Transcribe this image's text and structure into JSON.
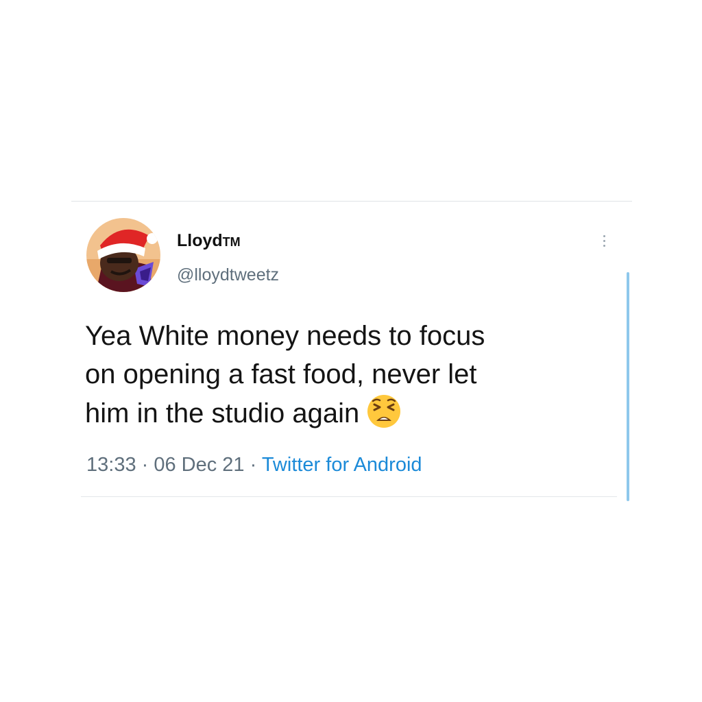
{
  "tweet": {
    "display_name": "Lloyd",
    "name_suffix": "TM",
    "handle": "@lloydtweetz",
    "text_lines": [
      "Yea White money needs to focus",
      "on opening a fast food, never let",
      "him in the studio again"
    ],
    "emoji": "tired-face-emoji",
    "time": "13:33",
    "separator": " · ",
    "date": "06 Dec 21",
    "source": "Twitter for Android"
  },
  "icons": {
    "more": "vertical-ellipsis-icon",
    "avatar": "cartoon-avatar-santa-hat"
  },
  "colors": {
    "link": "#1b8ad8",
    "scroll_indicator": "#8ec8ec",
    "secondary_text": "#5f6f7c"
  }
}
